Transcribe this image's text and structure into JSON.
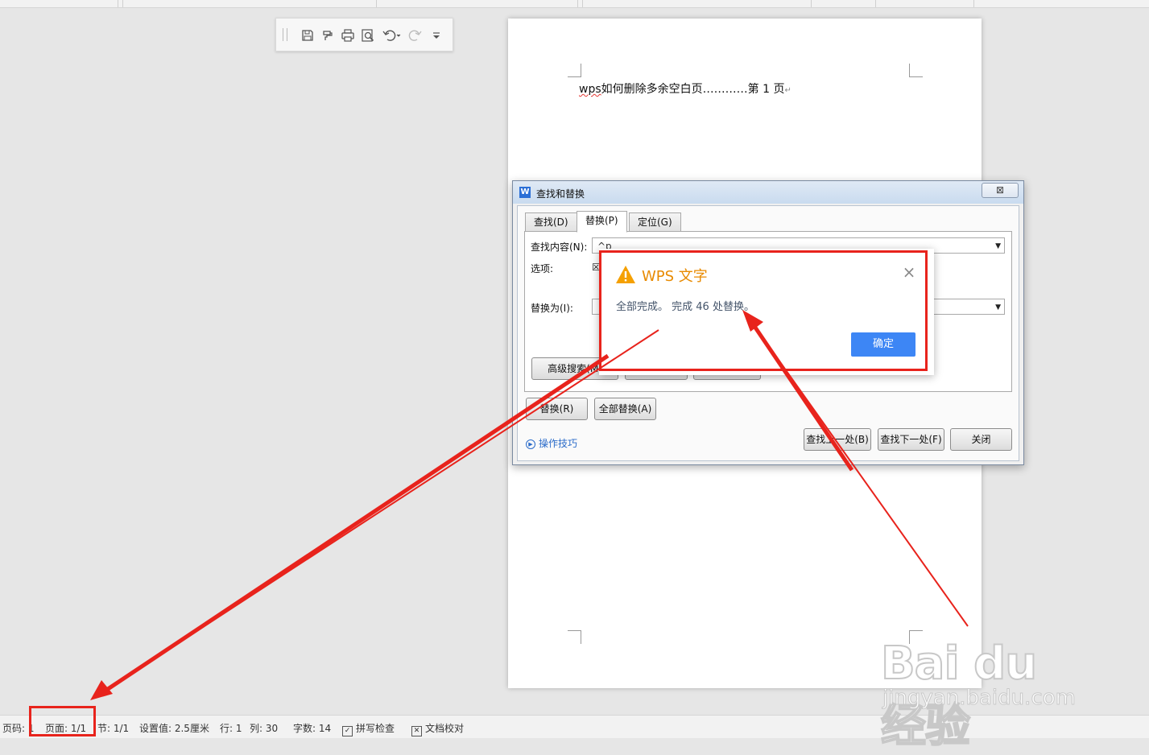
{
  "quick_access": {
    "icons": [
      "save-icon",
      "format-painter-icon",
      "print-icon",
      "print-preview-icon",
      "undo-icon",
      "redo-icon",
      "customize-dropdown-icon"
    ]
  },
  "document": {
    "line_word": "wps",
    "line_rest": "如何删除多余空白页…………第 1 页",
    "line_mark": "↵"
  },
  "find_replace_dialog": {
    "title": "查找和替换",
    "app_icon_letter": "W",
    "close_glyph": "⊠",
    "tabs": [
      "查找(D)",
      "替换(P)",
      "定位(G)"
    ],
    "active_tab": "替换(P)",
    "find_label": "查找内容(N):",
    "find_value": "^p",
    "options_label": "选项:",
    "options_checkbox": "☒",
    "replace_label": "替换为(I):",
    "replace_value": "",
    "advanced_button": "高级搜索(M)",
    "replace_button": "替换(R)",
    "replace_all_button": "全部替换(A)",
    "tips_link": "操作技巧",
    "find_prev_button": "查找上一处(B)",
    "find_next_button": "查找下一处(F)",
    "close_button": "关闭"
  },
  "message_box": {
    "title": "WPS 文字",
    "text": "全部完成。 完成 46 处替换。",
    "ok_button": "确定",
    "close_glyph": "×"
  },
  "status_bar": {
    "page_code": "页码: 1",
    "pages": "页面: 1/1",
    "section": "节: 1/1",
    "setting": "设置值: 2.5厘米",
    "row": "行: 1",
    "col": "列: 30",
    "word_count": "字数: 14",
    "spell_check": "拼写检查",
    "proofread": "文档校对"
  },
  "watermark": {
    "logo_text": "Bai du 经验",
    "url": "jingyan.baidu.com"
  },
  "colors": {
    "annotation_red": "#e8231c",
    "warning_orange": "#e88a00",
    "ok_blue": "#3d86f5",
    "link_blue": "#2a6bc9"
  }
}
